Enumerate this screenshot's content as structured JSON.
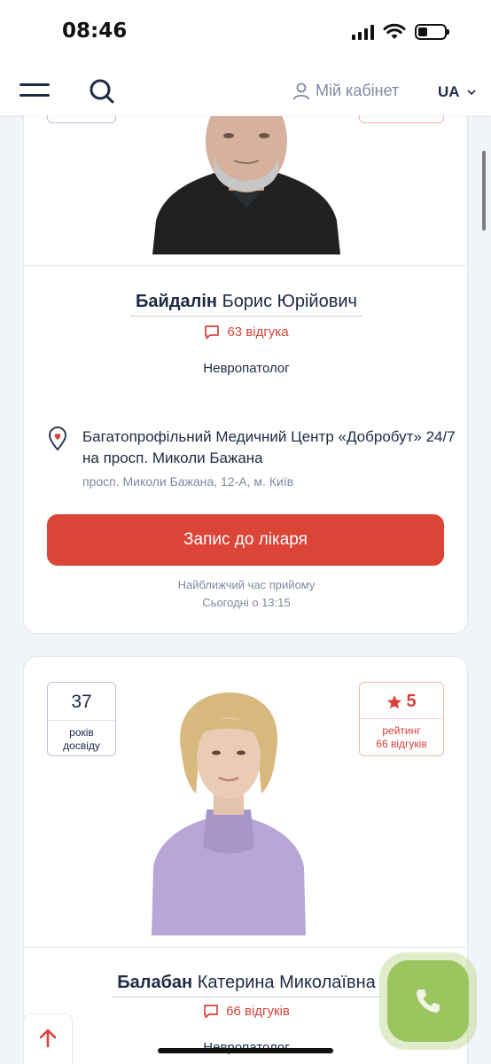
{
  "status_bar": {
    "time": "08:46"
  },
  "header": {
    "cabinet_label": "Мій кабінет",
    "language": "UA"
  },
  "doctors": [
    {
      "surname": "Байдалін",
      "given_names": "Борис Юрійович",
      "reviews": "63 відгука",
      "specialty": "Невропатолог",
      "clinic_name": "Багатопрофільний Медичний Центр «Добробут» 24/7 на просп. Миколи Бажана",
      "clinic_address": "просп. Миколи Бажана, 12-А, м. Київ",
      "book_label": "Запис до лікаря",
      "nearest_label": "Найближчий час прийому",
      "nearest_time": "Сьогодні о 13:15"
    },
    {
      "experience_years": "37",
      "experience_label_1": "років",
      "experience_label_2": "досвіду",
      "rating": "5",
      "rating_label": "рейтинг",
      "rating_reviews": "66 відгуків",
      "surname": "Балабан",
      "given_names": "Катерина Миколаївна",
      "reviews": "66 відгуків",
      "specialty": "Невропатолог"
    }
  ],
  "colors": {
    "accent_red": "#db4436",
    "navy": "#1d2a44",
    "call_green": "#9bc55e"
  }
}
